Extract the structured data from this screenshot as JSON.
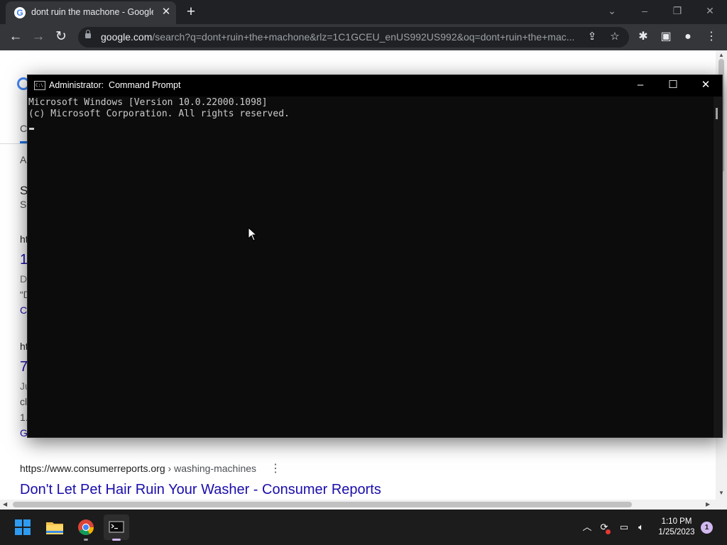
{
  "browser": {
    "tab": {
      "title": "dont ruin the machone - Google",
      "favicon": "google-g-icon",
      "favicon_glyph": "G"
    },
    "new_tab_glyph": "+",
    "url_host": "google.com",
    "url_rest": "/search?q=dont+ruin+the+machone&rlz=1C1GCEU_enUS992US992&oq=dont+ruin+the+mac...",
    "nav_icons": [
      "back-arrow-icon",
      "forward-arrow-icon",
      "reload-icon"
    ],
    "toolbar_icons": [
      "share-icon",
      "star-bookmark-icon",
      "extensions-puzzle-icon",
      "side-panel-icon",
      "profile-icon",
      "more-menu-icon"
    ],
    "accent": "#35363a"
  },
  "page": {
    "fragments": [
      "C",
      "A",
      "S",
      "S",
      "ht",
      "1",
      "D",
      "“D",
      "C",
      "ht",
      "7",
      "Ju",
      "cl",
      "1.",
      "G"
    ],
    "result": {
      "url_site": "https://www.consumerreports.org",
      "url_crumb": " › washing-machines",
      "title": "Don't Let Pet Hair Ruin Your Washer - Consumer Reports"
    }
  },
  "cmd": {
    "title": "Administrator:  Command Prompt",
    "lines": "Microsoft Windows [Version 10.0.22000.1098]\n(c) Microsoft Corporation. All rights reserved.",
    "icon_glyph": "C:\\"
  },
  "taskbar": {
    "apps": [
      "windows-start-icon",
      "file-explorer-icon",
      "chrome-icon",
      "terminal-icon"
    ],
    "tray_icons": [
      "chevron-up-icon",
      "sync-icon",
      "network-icon",
      "volume-icon"
    ],
    "time": "1:10 PM",
    "date": "1/25/2023",
    "notification_count": "1"
  }
}
